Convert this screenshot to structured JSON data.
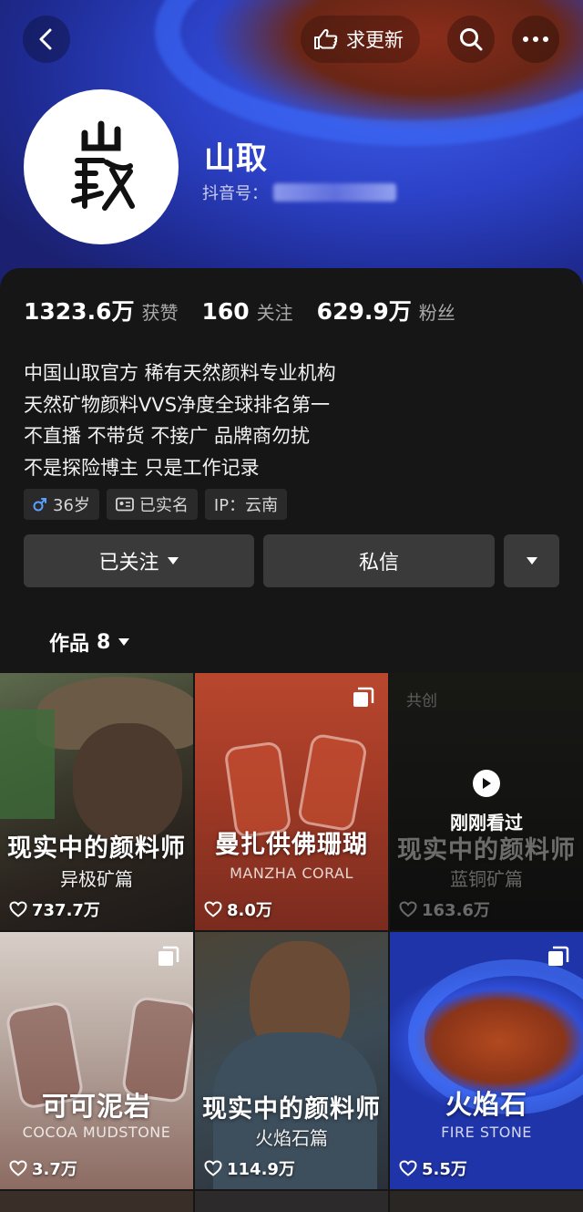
{
  "topbar": {
    "update_request": "求更新"
  },
  "profile": {
    "avatar_calligraphy": "山取",
    "name": "山取",
    "douyin_id_label": "抖音号："
  },
  "stats": [
    {
      "value": "1323.6万",
      "label": "获赞"
    },
    {
      "value": "160",
      "label": "关注"
    },
    {
      "value": "629.9万",
      "label": "粉丝"
    }
  ],
  "bio": [
    "中国山取官方 稀有天然颜料专业机构",
    "天然矿物颜料VVS净度全球排名第一",
    "不直播 不带货 不接广 品牌商勿扰",
    "不是探险博主 只是工作记录"
  ],
  "tags": {
    "age": "36岁",
    "verified": "已实名",
    "ip": "IP：云南"
  },
  "actions": {
    "followed": "已关注",
    "message": "私信"
  },
  "works_tab": {
    "label": "作品",
    "count": "8"
  },
  "videos": [
    {
      "title": "现实中的颜料师",
      "subtitle": "异极矿篇",
      "likes": "737.7万"
    },
    {
      "title": "曼扎供佛珊瑚",
      "subtitle_en": "MANZHA CORAL",
      "likes": "8.0万"
    },
    {
      "badge": "共创",
      "watched": "刚刚看过",
      "title": "现实中的颜料师",
      "subtitle": "蓝铜矿篇",
      "likes": "163.6万"
    },
    {
      "title": "可可泥岩",
      "subtitle_en": "COCOA MUDSTONE",
      "likes": "3.7万"
    },
    {
      "title": "现实中的颜料师",
      "subtitle": "火焰石篇",
      "likes": "114.9万"
    },
    {
      "title": "火焰石",
      "subtitle_en": "FIRE STONE",
      "likes": "5.5万"
    }
  ],
  "colors": {
    "background": "#161616",
    "banner_blue": "#2c42c8",
    "button": "#3a3a3a",
    "male_icon": "#5aa0ff"
  }
}
